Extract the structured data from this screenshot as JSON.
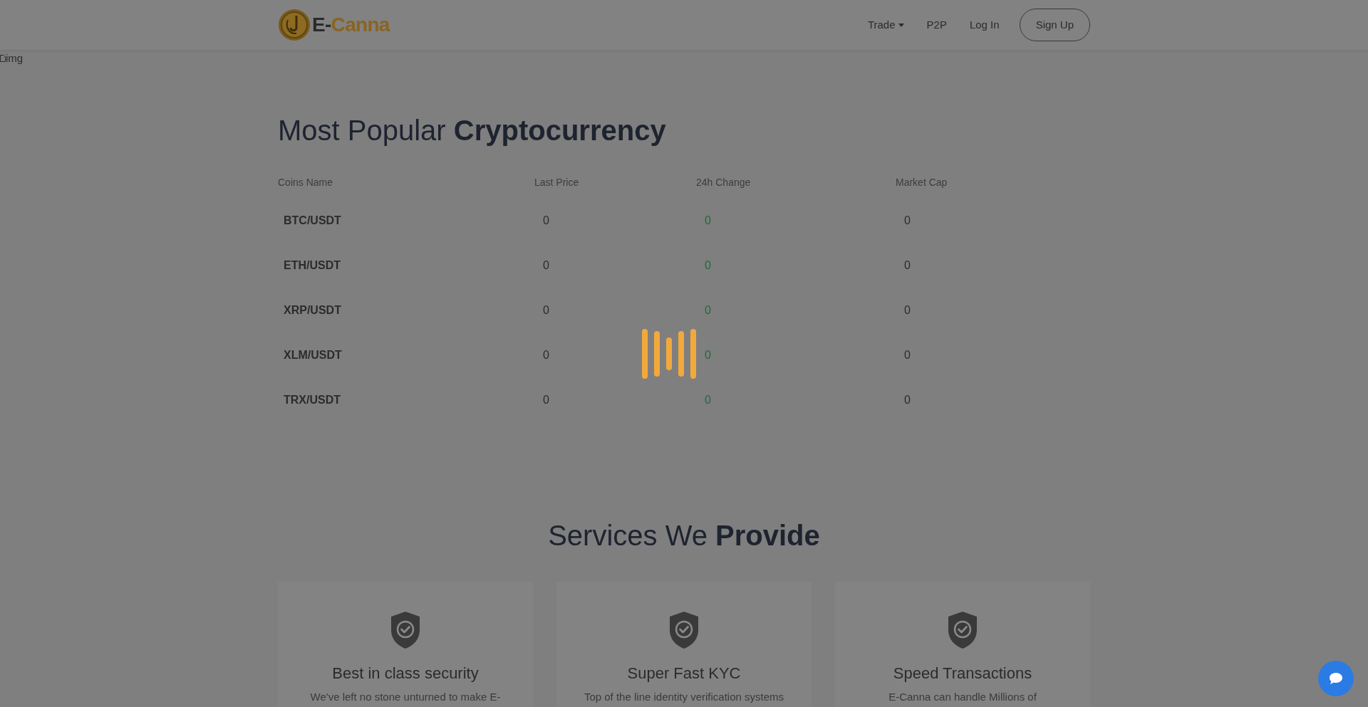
{
  "brand": {
    "prefix": "E-",
    "name": "Canna"
  },
  "nav": [
    {
      "label": "Trade",
      "kind": "dropdown"
    },
    {
      "label": "P2P",
      "kind": "link"
    },
    {
      "label": "Log In",
      "kind": "link"
    },
    {
      "label": "Sign Up",
      "kind": "button"
    }
  ],
  "banner_image": {
    "alt": "img"
  },
  "market": {
    "heading": "Most Popular **Cryptocurrency**",
    "columns": [
      "Coins Name",
      "Last Price",
      "24h Change",
      "Market Cap"
    ],
    "rows": [
      {
        "pair": "BTC/USDT",
        "last_price": "0",
        "change": "0",
        "market_cap": "0"
      },
      {
        "pair": "ETH/USDT",
        "last_price": "0",
        "change": "0",
        "market_cap": "0"
      },
      {
        "pair": "XRP/USDT",
        "last_price": "0",
        "change": "0",
        "market_cap": "0"
      },
      {
        "pair": "XLM/USDT",
        "last_price": "0",
        "change": "0",
        "market_cap": "0"
      },
      {
        "pair": "TRX/USDT",
        "last_price": "0",
        "change": "0",
        "market_cap": "0"
      }
    ]
  },
  "services": {
    "heading": "Services We **Provide**",
    "cards": [
      {
        "title": "Best in class security",
        "text": "We've left no stone unturned to make E-"
      },
      {
        "title": "Super Fast KYC",
        "text": "Top of the line identity verification systems"
      },
      {
        "title": "Speed Transactions",
        "text": "E-Canna can handle Millions of"
      }
    ]
  }
}
